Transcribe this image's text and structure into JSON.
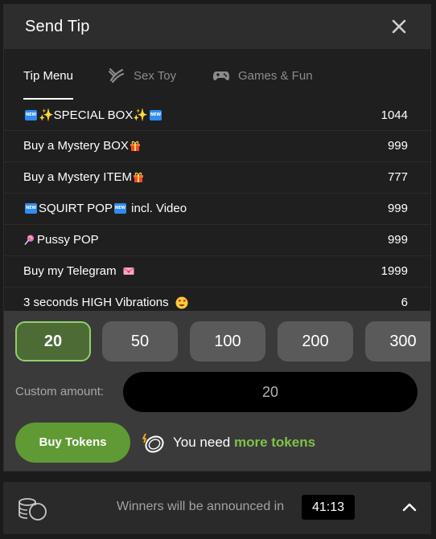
{
  "modal": {
    "title": "Send Tip",
    "close_icon": "close-icon"
  },
  "tabs": [
    {
      "label": "Tip Menu",
      "active": true,
      "icon": ""
    },
    {
      "label": "Sex Toy",
      "active": false,
      "icon": "toy-icon"
    },
    {
      "label": "Games & Fun",
      "active": false,
      "icon": "gamepad-icon"
    }
  ],
  "menu_items": [
    {
      "name": "✨SPECIAL BOX✨",
      "prefix_badge": "NEW",
      "suffix_badge": "NEW",
      "price": "1044"
    },
    {
      "name": "Buy a Mystery BOX",
      "suffix_icon": "gift-icon",
      "price": "999"
    },
    {
      "name": "Buy a Mystery ITEM",
      "suffix_icon": "gift-icon",
      "price": "777"
    },
    {
      "name": "SQUIRT POP",
      "prefix_badge": "NEW",
      "middle_badge": "NEW",
      "name_tail": " incl. Video",
      "price": "999"
    },
    {
      "name": "Pussy POP",
      "prefix_icon": "lollipop-icon",
      "price": "999"
    },
    {
      "name": "Buy my Telegram ",
      "suffix_icon": "love-letter-icon",
      "price": "1999"
    },
    {
      "name": "3 seconds HIGH Vibrations ",
      "suffix_icon": "heart-eyes-icon",
      "price": "6"
    }
  ],
  "badge_text": "NEW",
  "amounts": [
    {
      "value": "20",
      "selected": true
    },
    {
      "value": "50",
      "selected": false
    },
    {
      "value": "100",
      "selected": false
    },
    {
      "value": "200",
      "selected": false
    },
    {
      "value": "300",
      "selected": false
    }
  ],
  "custom_amount": {
    "label": "Custom amount:",
    "value": "20"
  },
  "buy_button": {
    "label": "Buy Tokens"
  },
  "need_tokens": {
    "prefix": "You need ",
    "link": "more tokens"
  },
  "footer": {
    "text": "Winners will be announced in",
    "timer": "41:13"
  },
  "colors": {
    "accent_green": "#5f9a35",
    "link_green": "#7fc24a",
    "new_badge": "#2f8cf0"
  }
}
